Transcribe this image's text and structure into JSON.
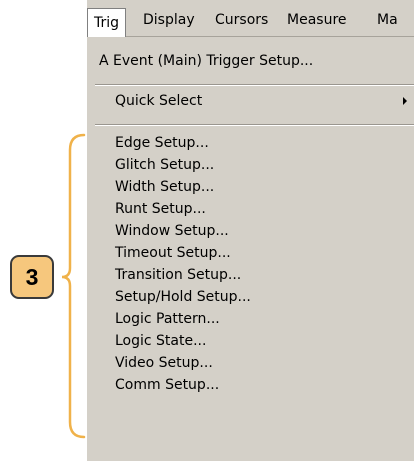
{
  "menubar": {
    "items": [
      {
        "label": "Trig"
      },
      {
        "label": "Display"
      },
      {
        "label": "Cursors"
      },
      {
        "label": "Measure"
      },
      {
        "label": "Ma"
      }
    ]
  },
  "trig_menu": {
    "main_trigger": "A Event (Main) Trigger Setup...",
    "quick_select": "Quick Select",
    "setups": [
      "Edge Setup...",
      "Glitch Setup...",
      "Width Setup...",
      "Runt Setup...",
      "Window Setup...",
      "Timeout Setup...",
      "Transition Setup...",
      "Setup/Hold Setup...",
      "Logic Pattern...",
      "Logic State...",
      "Video Setup...",
      "Comm Setup..."
    ]
  },
  "callout": {
    "number": "3",
    "color": "#f6c77d",
    "bracket_color": "#f0b24a"
  },
  "colors": {
    "menu_bg": "#d4d0c8",
    "active_tab_bg": "#ffffff"
  }
}
